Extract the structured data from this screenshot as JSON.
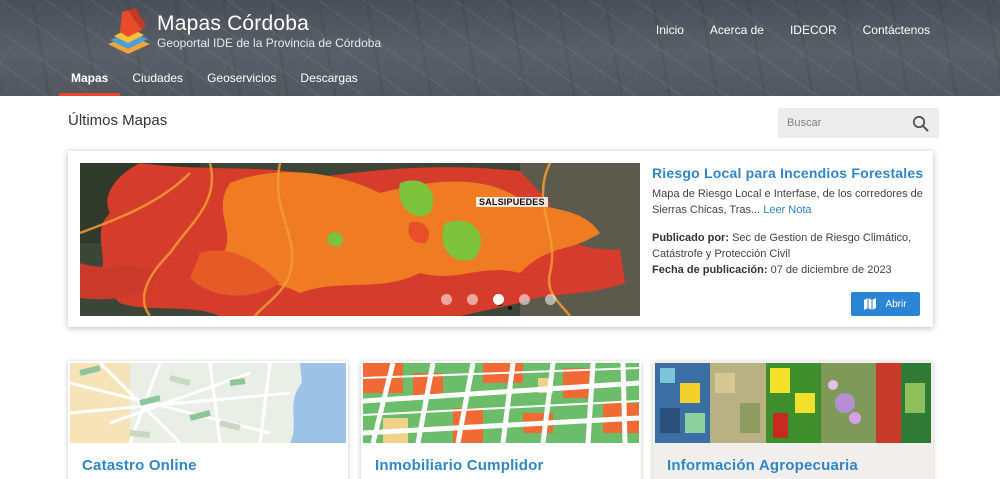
{
  "brand": {
    "title": "Mapas Córdoba",
    "subtitle": "Geoportal IDE de la Provincia de Córdoba"
  },
  "topnav": [
    "Inicio",
    "Acerca de",
    "IDECOR",
    "Contáctenos"
  ],
  "subnav": {
    "tabs": [
      "Mapas",
      "Ciudades",
      "Geoservicios",
      "Descargas"
    ],
    "active": "Mapas"
  },
  "section": {
    "title": "Últimos Mapas"
  },
  "search": {
    "placeholder": "Buscar",
    "icon": "search-icon"
  },
  "featured": {
    "title": "Riesgo Local para Incendios Forestales",
    "description": "Mapa de Riesgo Local e Interfase, de los corredores de Sierras Chicas, Tras...",
    "read_more": "Leer Nota",
    "published_by_label": "Publicado por:",
    "published_by": "Sec de Gestion de Riesgo Climático, Catástrofe y Protección Civil",
    "date_label": "Fecha de publicación:",
    "date": "07 de diciembre de 2023",
    "map_label": "SALSIPUEDES",
    "open_label": "Abrir",
    "open_icon": "map-icon",
    "carousel": {
      "slides": 5,
      "active_index": 2
    }
  },
  "cards": [
    {
      "title": "Catastro Online"
    },
    {
      "title": "Inmobiliario Cumplidor"
    },
    {
      "title": "Información Agropecuaria"
    }
  ],
  "colors": {
    "accent_blue": "#2f86c9",
    "button_blue": "#2a86d4",
    "active_tab_underline": "#e8452c",
    "header_bg": "#53585f"
  }
}
